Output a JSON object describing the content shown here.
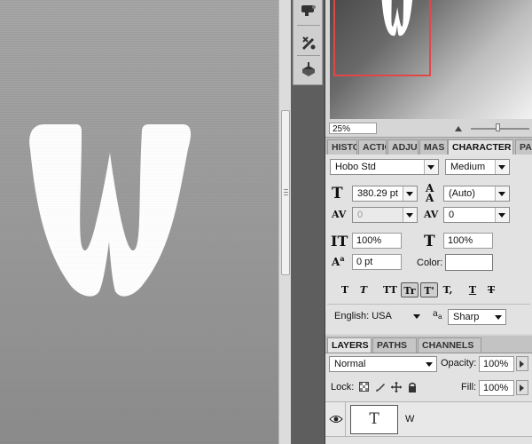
{
  "canvas": {
    "glyph": "W"
  },
  "navigator": {
    "zoom": "25%"
  },
  "panel_tabs": [
    {
      "label": "HISTO"
    },
    {
      "label": "ACTIO"
    },
    {
      "label": "ADJU"
    },
    {
      "label": "MAS"
    },
    {
      "label": "CHARACTER"
    },
    {
      "label": "PA"
    }
  ],
  "character": {
    "font_family": "Hobo Std",
    "font_style": "Medium",
    "font_size": "380.29 pt",
    "leading": "(Auto)",
    "kerning": "0",
    "tracking": "0",
    "vertical_scale": "100%",
    "horizontal_scale": "100%",
    "baseline_shift": "0 pt",
    "color_label": "Color:",
    "color_value": "#ffffff",
    "style_buttons": [
      "T",
      "T",
      "TT",
      "Tr",
      "T'",
      "T,",
      "T",
      "T"
    ],
    "language": "English: USA",
    "antialias_prefix": "a",
    "antialias_sub": "a",
    "antialias": "Sharp"
  },
  "layers_tabs": [
    {
      "label": "LAYERS"
    },
    {
      "label": "PATHS"
    },
    {
      "label": "CHANNELS"
    }
  ],
  "layers": {
    "blend_mode": "Normal",
    "opacity_label": "Opacity:",
    "opacity": "100%",
    "lock_label": "Lock:",
    "fill_label": "Fill:",
    "fill": "100%",
    "items": [
      {
        "name": "W",
        "thumb": "T",
        "visible": true
      }
    ]
  }
}
